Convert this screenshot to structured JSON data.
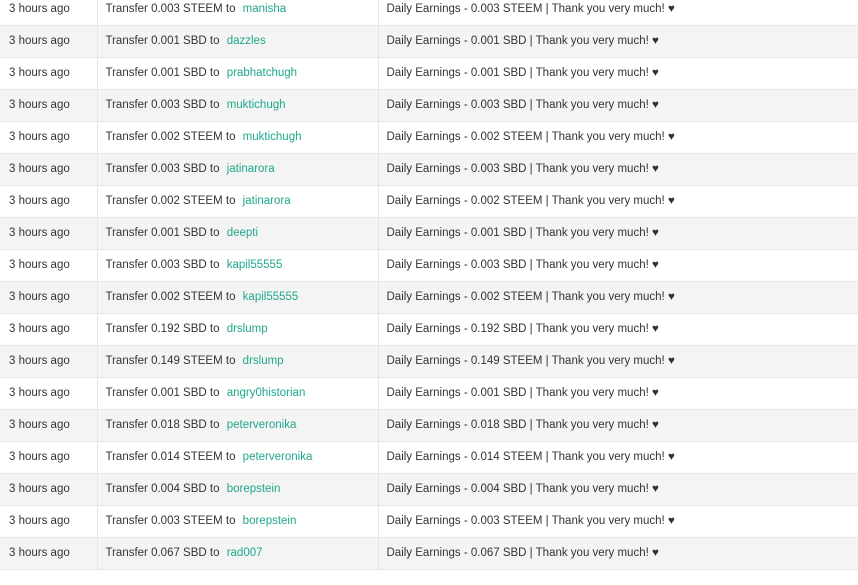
{
  "transfers": [
    {
      "time": "3 hours ago",
      "prefix": "Transfer 0.003 STEEM to",
      "account": "manisha",
      "memo": "Daily Earnings - 0.003 STEEM | Thank you very much! ♥"
    },
    {
      "time": "3 hours ago",
      "prefix": "Transfer 0.001 SBD to",
      "account": "dazzles",
      "memo": "Daily Earnings - 0.001 SBD | Thank you very much! ♥"
    },
    {
      "time": "3 hours ago",
      "prefix": "Transfer 0.001 SBD to",
      "account": "prabhatchugh",
      "memo": "Daily Earnings - 0.001 SBD | Thank you very much! ♥"
    },
    {
      "time": "3 hours ago",
      "prefix": "Transfer 0.003 SBD to",
      "account": "muktichugh",
      "memo": "Daily Earnings - 0.003 SBD | Thank you very much! ♥"
    },
    {
      "time": "3 hours ago",
      "prefix": "Transfer 0.002 STEEM to",
      "account": "muktichugh",
      "memo": "Daily Earnings - 0.002 STEEM | Thank you very much! ♥"
    },
    {
      "time": "3 hours ago",
      "prefix": "Transfer 0.003 SBD to",
      "account": "jatinarora",
      "memo": "Daily Earnings - 0.003 SBD | Thank you very much! ♥"
    },
    {
      "time": "3 hours ago",
      "prefix": "Transfer 0.002 STEEM to",
      "account": "jatinarora",
      "memo": "Daily Earnings - 0.002 STEEM | Thank you very much! ♥"
    },
    {
      "time": "3 hours ago",
      "prefix": "Transfer 0.001 SBD to",
      "account": "deepti",
      "memo": "Daily Earnings - 0.001 SBD | Thank you very much! ♥"
    },
    {
      "time": "3 hours ago",
      "prefix": "Transfer 0.003 SBD to",
      "account": "kapil55555",
      "memo": "Daily Earnings - 0.003 SBD | Thank you very much! ♥"
    },
    {
      "time": "3 hours ago",
      "prefix": "Transfer 0.002 STEEM to",
      "account": "kapil55555",
      "memo": "Daily Earnings - 0.002 STEEM | Thank you very much! ♥"
    },
    {
      "time": "3 hours ago",
      "prefix": "Transfer 0.192 SBD to",
      "account": "drslump",
      "memo": "Daily Earnings - 0.192 SBD | Thank you very much! ♥"
    },
    {
      "time": "3 hours ago",
      "prefix": "Transfer 0.149 STEEM to",
      "account": "drslump",
      "memo": "Daily Earnings - 0.149 STEEM | Thank you very much! ♥"
    },
    {
      "time": "3 hours ago",
      "prefix": "Transfer 0.001 SBD to",
      "account": "angry0historian",
      "memo": "Daily Earnings - 0.001 SBD | Thank you very much! ♥"
    },
    {
      "time": "3 hours ago",
      "prefix": "Transfer 0.018 SBD to",
      "account": "peterveronika",
      "memo": "Daily Earnings - 0.018 SBD | Thank you very much! ♥"
    },
    {
      "time": "3 hours ago",
      "prefix": "Transfer 0.014 STEEM to",
      "account": "peterveronika",
      "memo": "Daily Earnings - 0.014 STEEM | Thank you very much! ♥"
    },
    {
      "time": "3 hours ago",
      "prefix": "Transfer 0.004 SBD to",
      "account": "borepstein",
      "memo": "Daily Earnings - 0.004 SBD | Thank you very much! ♥"
    },
    {
      "time": "3 hours ago",
      "prefix": "Transfer 0.003 STEEM to",
      "account": "borepstein",
      "memo": "Daily Earnings - 0.003 STEEM | Thank you very much! ♥"
    },
    {
      "time": "3 hours ago",
      "prefix": "Transfer 0.067 SBD to",
      "account": "rad007",
      "memo": "Daily Earnings - 0.067 SBD | Thank you very much! ♥"
    }
  ],
  "colors": {
    "link": "#1fa78a",
    "text": "#333333",
    "row_alt": "#f4f4f4",
    "border": "#e6e6e6"
  }
}
